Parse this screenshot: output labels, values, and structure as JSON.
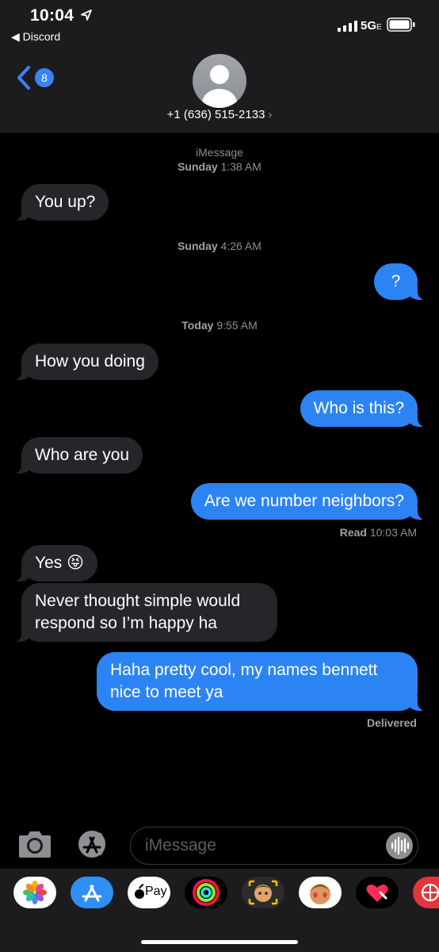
{
  "status_bar": {
    "time": "10:04",
    "back_app": "◀ Discord",
    "network": "5G",
    "network_suffix": "E"
  },
  "header": {
    "unread_count": "8",
    "contact": "+1 (636) 515-2133",
    "contact_chevron": "›"
  },
  "conversation": {
    "service_label": "iMessage",
    "timestamps": [
      {
        "day": "Sunday",
        "time": "1:38 AM"
      },
      {
        "day": "Sunday",
        "time": "4:26 AM"
      },
      {
        "day": "Today",
        "time": "9:55 AM"
      }
    ],
    "messages": [
      {
        "direction": "incoming",
        "text": "You up?"
      },
      {
        "direction": "outgoing",
        "text": "?"
      },
      {
        "direction": "incoming",
        "text": "How you doing"
      },
      {
        "direction": "outgoing",
        "text": "Who is this?"
      },
      {
        "direction": "incoming",
        "text": "Who are you"
      },
      {
        "direction": "outgoing",
        "text": "Are we number neighbors?"
      },
      {
        "direction": "incoming",
        "text": "Yes 😝"
      },
      {
        "direction": "incoming",
        "text": "Never thought simple would respond so I’m happy ha"
      },
      {
        "direction": "outgoing",
        "text": "Haha pretty cool, my names bennett nice to meet ya"
      }
    ],
    "read_receipt": {
      "label": "Read",
      "time": "10:03 AM"
    },
    "delivered_label": "Delivered"
  },
  "composer": {
    "placeholder": "iMessage"
  },
  "app_drawer": {
    "apps": [
      "photos-icon",
      "app-store-icon",
      "apple-pay-icon",
      "activity-icon",
      "memoji-icon",
      "animoji-icon",
      "digital-touch-icon",
      "web-icon"
    ],
    "apple_pay_label": "Pay"
  },
  "colors": {
    "outgoing_bubble": "#2c84f4",
    "incoming_bubble": "#26252a",
    "badge": "#3b82f6",
    "background": "#000000",
    "bars": "#1c1c1e"
  }
}
